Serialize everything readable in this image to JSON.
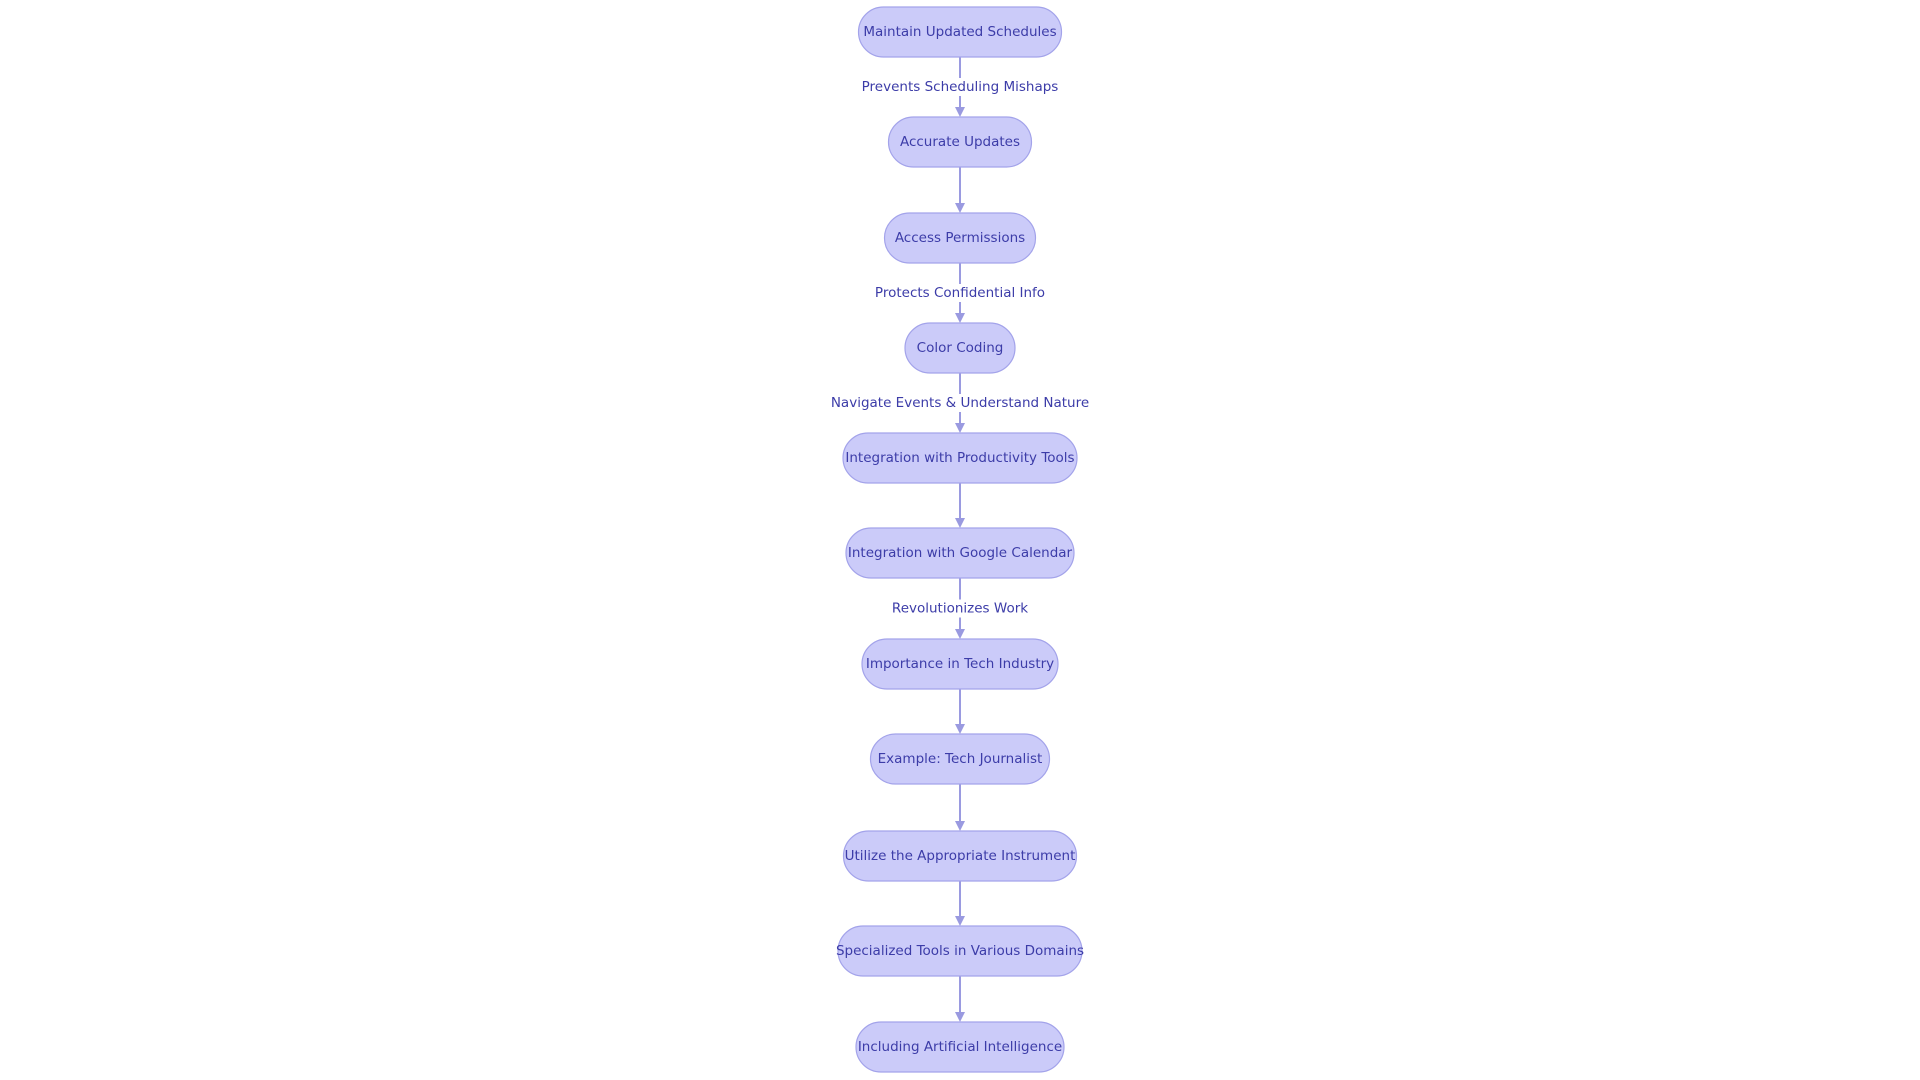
{
  "diagram": {
    "type": "flowchart",
    "direction": "top-to-bottom",
    "colors": {
      "node_fill": "#cbcbf9",
      "node_stroke": "#a3a3ea",
      "text": "#3c3ca8",
      "edge": "#9a9ae0"
    },
    "nodes": [
      {
        "id": "n0",
        "label": "Maintain Updated Schedules"
      },
      {
        "id": "n1",
        "label": "Accurate Updates"
      },
      {
        "id": "n2",
        "label": "Access Permissions"
      },
      {
        "id": "n3",
        "label": "Color Coding"
      },
      {
        "id": "n4",
        "label": "Integration with Productivity Tools"
      },
      {
        "id": "n5",
        "label": "Integration with Google Calendar"
      },
      {
        "id": "n6",
        "label": "Importance in Tech Industry"
      },
      {
        "id": "n7",
        "label": "Example: Tech Journalist"
      },
      {
        "id": "n8",
        "label": "Utilize the Appropriate Instrument"
      },
      {
        "id": "n9",
        "label": "Specialized Tools in Various Domains"
      },
      {
        "id": "n10",
        "label": "Including Artificial Intelligence"
      }
    ],
    "edges": [
      {
        "from": "n0",
        "to": "n1",
        "label": "Prevents Scheduling Mishaps"
      },
      {
        "from": "n1",
        "to": "n2",
        "label": ""
      },
      {
        "from": "n2",
        "to": "n3",
        "label": "Protects Confidential Info"
      },
      {
        "from": "n3",
        "to": "n4",
        "label": "Navigate Events & Understand Nature"
      },
      {
        "from": "n4",
        "to": "n5",
        "label": ""
      },
      {
        "from": "n5",
        "to": "n6",
        "label": "Revolutionizes Work"
      },
      {
        "from": "n6",
        "to": "n7",
        "label": ""
      },
      {
        "from": "n7",
        "to": "n8",
        "label": ""
      },
      {
        "from": "n8",
        "to": "n9",
        "label": ""
      },
      {
        "from": "n9",
        "to": "n10",
        "label": ""
      }
    ]
  }
}
